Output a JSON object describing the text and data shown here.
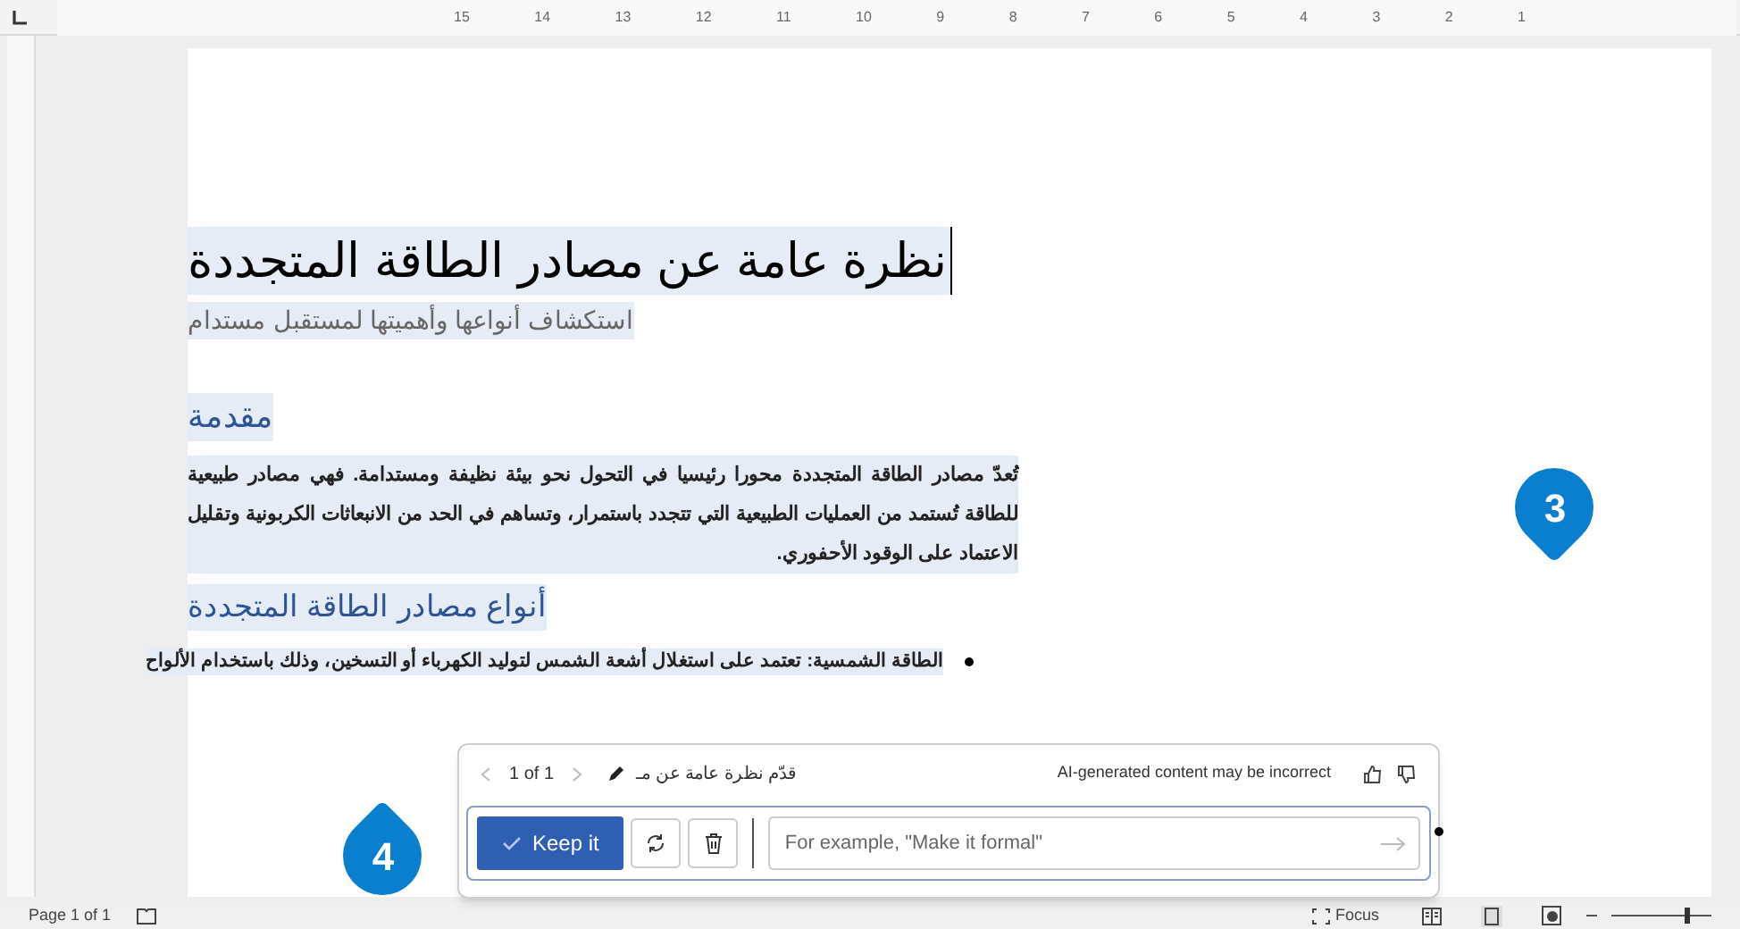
{
  "ruler": {
    "numbers": [
      "1",
      "2",
      "3",
      "4",
      "5",
      "6",
      "7",
      "8",
      "9",
      "10",
      "11",
      "12",
      "13",
      "14",
      "15"
    ]
  },
  "document": {
    "title": "نظرة عامة عن مصادر الطاقة المتجددة",
    "subtitle": "استكشاف أنواعها وأهميتها لمستقبل مستدام",
    "heading_1": "مقدمة",
    "paragraph": "تُعدّ مصادر الطاقة المتجددة محورا رئيسيا في التحول نحو بيئة نظيفة ومستدامة. فهي مصادر طبيعية للطاقة تُستمد من العمليات الطبيعية التي تتجدد باستمرار، وتساهم في الحد من الانبعاثات الكربونية وتقليل الاعتماد على الوقود الأحفوري.",
    "heading_2": "أنواع مصادر الطاقة المتجددة",
    "bullets": [
      "الطاقة الشمسية: تعتمد على استغلال أشعة الشمس لتوليد الكهرباء أو التسخين، وذلك باستخدام الألواح"
    ]
  },
  "callouts": [
    "3",
    "4"
  ],
  "copilot_panel": {
    "pager": "1 of 1",
    "prompt": "قدّم نظرة عامة عن مـ",
    "disclaimer": "AI-generated content may be incorrect",
    "keep_button": "Keep it",
    "input_placeholder": "For example, \"Make it formal\""
  },
  "status_bar": {
    "page": "Page 1 of 1",
    "focus": "Focus",
    "zoom": {
      "level": 0.75
    }
  }
}
